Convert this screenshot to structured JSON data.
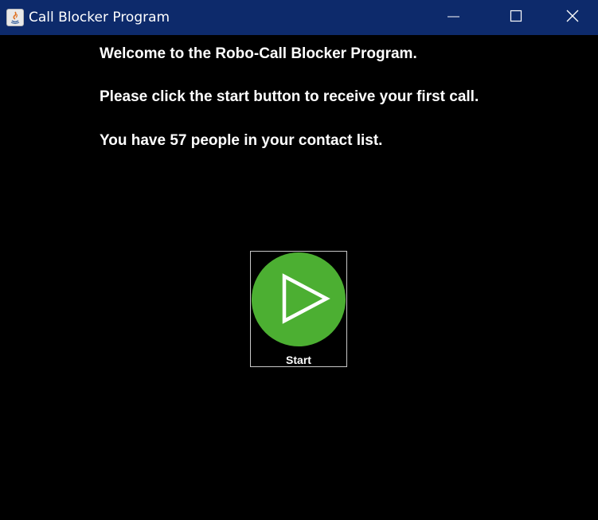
{
  "window": {
    "title": "Call Blocker Program",
    "controls": {
      "minimize": "minimize-icon",
      "maximize": "maximize-icon",
      "close": "close-icon"
    }
  },
  "messages": {
    "welcome": "Welcome to the Robo-Call Blocker Program.",
    "instruction": "Please click the start button to receive your first call.",
    "contacts": "You have 57 people in your contact list."
  },
  "start_button": {
    "label": "Start",
    "icon": "play-icon",
    "color": "#4caf32"
  },
  "colors": {
    "titlebar": "#0d2a6b",
    "background": "#000000",
    "text": "#ffffff"
  }
}
